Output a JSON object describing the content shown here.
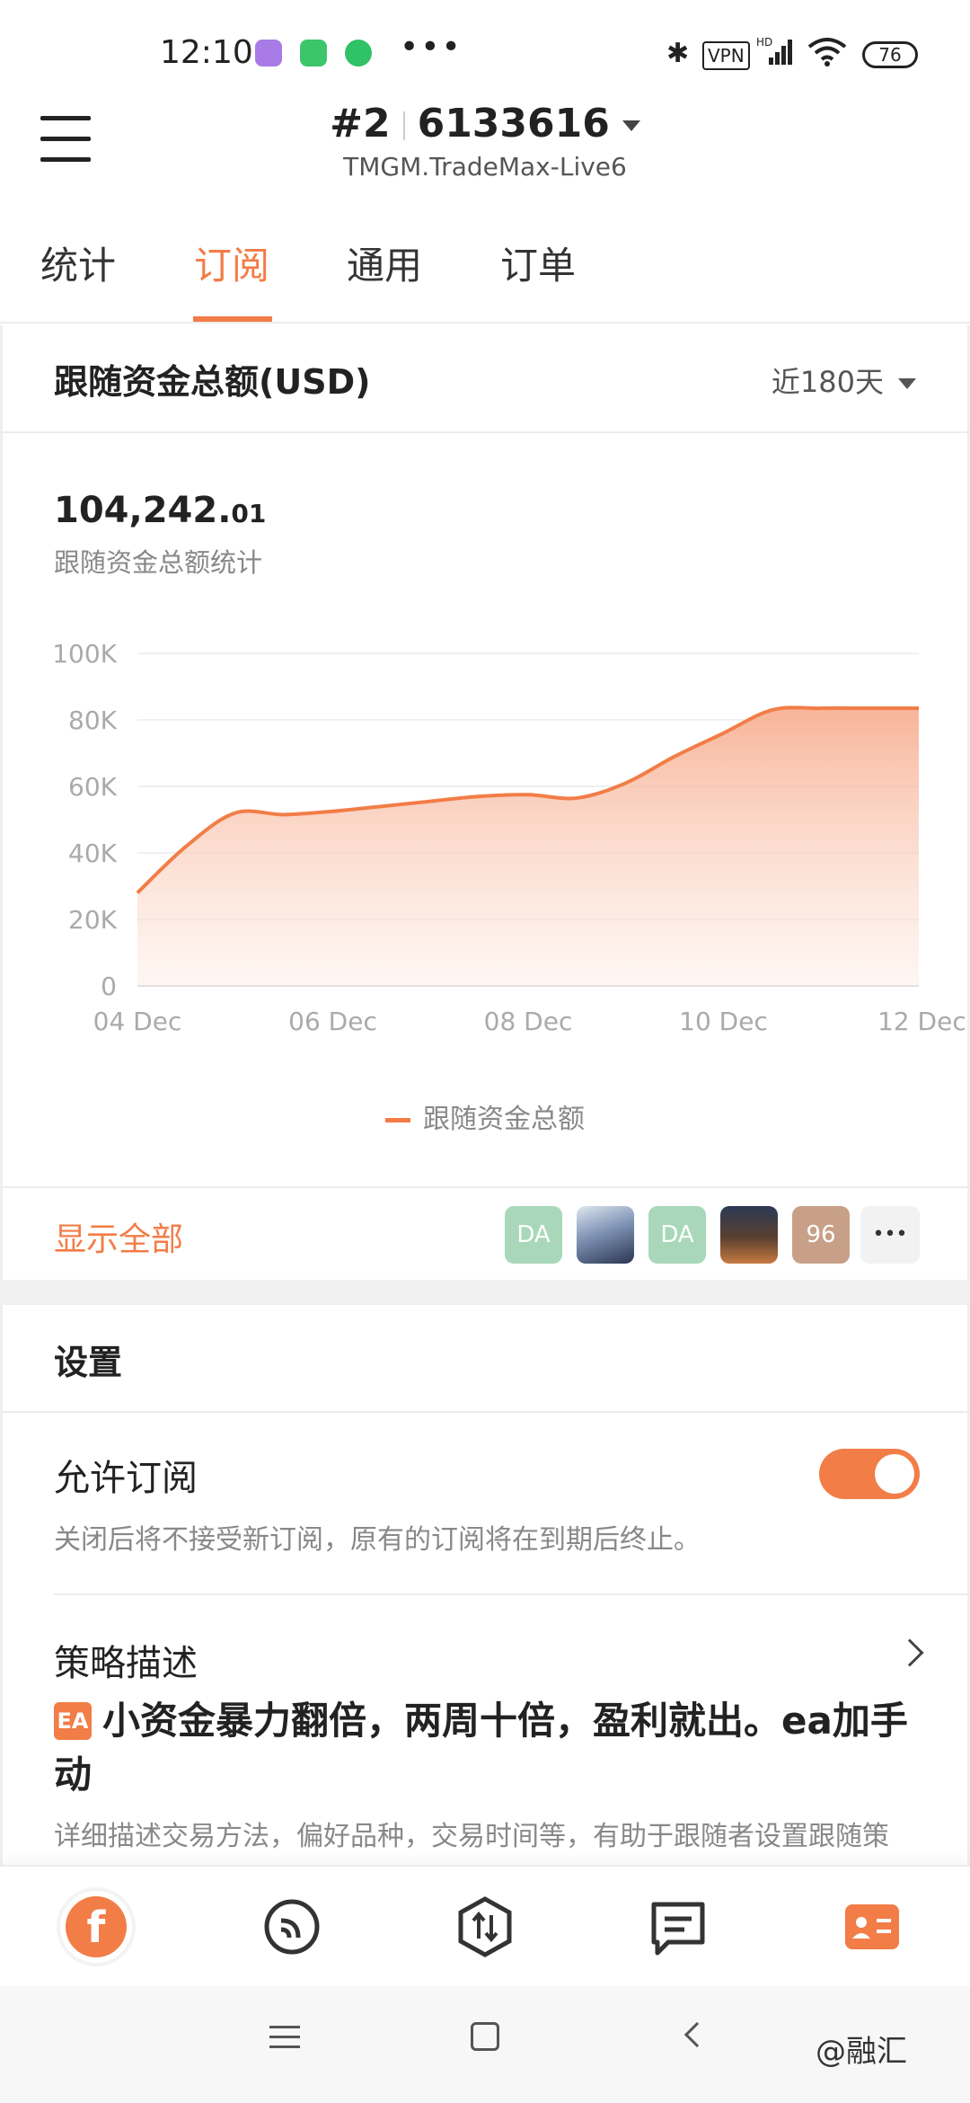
{
  "status_bar": {
    "time": "12:10",
    "more": "•••",
    "vpn": "VPN",
    "hd": "HD",
    "battery": "76"
  },
  "header": {
    "account_num": "#2",
    "account_id": "6133616",
    "server": "TMGM.TradeMax-Live6"
  },
  "tabs": [
    {
      "label": "统计"
    },
    {
      "label": "订阅"
    },
    {
      "label": "通用"
    },
    {
      "label": "订单"
    }
  ],
  "active_tab": "订阅",
  "chart_section": {
    "title": "跟随资金总额(USD)",
    "range": "近180天",
    "total_main": "104,242.",
    "total_decimal": "01",
    "total_label": "跟随资金总额统计"
  },
  "chart_data": {
    "type": "area",
    "x": [
      "04 Dec",
      "04.5",
      "05 Dec",
      "05.5",
      "06 Dec",
      "06.5",
      "07 Dec",
      "07.5",
      "08 Dec",
      "08.5",
      "09 Dec",
      "09.5",
      "10 Dec",
      "10.5",
      "11 Dec",
      "11.5",
      "12 Dec"
    ],
    "x_ticks": [
      "04 Dec",
      "06 Dec",
      "08 Dec",
      "10 Dec",
      "12 Dec"
    ],
    "y_ticks": [
      "100K",
      "80K",
      "60K",
      "40K",
      "20K",
      "0"
    ],
    "ylim": [
      0,
      100000
    ],
    "series": [
      {
        "name": "跟随资金总额",
        "color": "#f27d47",
        "values": [
          28000,
          42000,
          52000,
          51500,
          52500,
          54000,
          55500,
          57000,
          57500,
          56500,
          61000,
          69000,
          76000,
          83000,
          83500,
          83500,
          83500
        ]
      }
    ]
  },
  "followers": {
    "show_all": "显示全部",
    "avatars": [
      {
        "type": "initials",
        "text": "DA",
        "color": "#a8d8b9"
      },
      {
        "type": "photo",
        "text": "",
        "color": "#5a6b8c"
      },
      {
        "type": "initials",
        "text": "DA",
        "color": "#a8d8b9"
      },
      {
        "type": "photo",
        "text": "",
        "color": "#3a2f28"
      },
      {
        "type": "count",
        "text": "96",
        "color": "#c8a088"
      }
    ],
    "more": "•••"
  },
  "settings": {
    "title": "设置",
    "allow_subscription": "允许订阅",
    "allow_desc": "关闭后将不接受新订阅，原有的订阅将在到期后终止。",
    "allow_enabled": true,
    "strategy_title": "策略描述",
    "ea_badge": "EA",
    "strategy_text": "小资金暴力翻倍，两周十倍，盈利就出。ea加手动",
    "strategy_desc": "详细描述交易方法，偏好品种，交易时间等，有助于跟随者设置跟随策略。"
  },
  "bottom_nav": [
    {
      "icon": "home-logo-icon"
    },
    {
      "icon": "signal-icon"
    },
    {
      "icon": "trade-icon"
    },
    {
      "icon": "message-icon"
    },
    {
      "icon": "profile-card-icon"
    }
  ],
  "watermark": "@融汇"
}
